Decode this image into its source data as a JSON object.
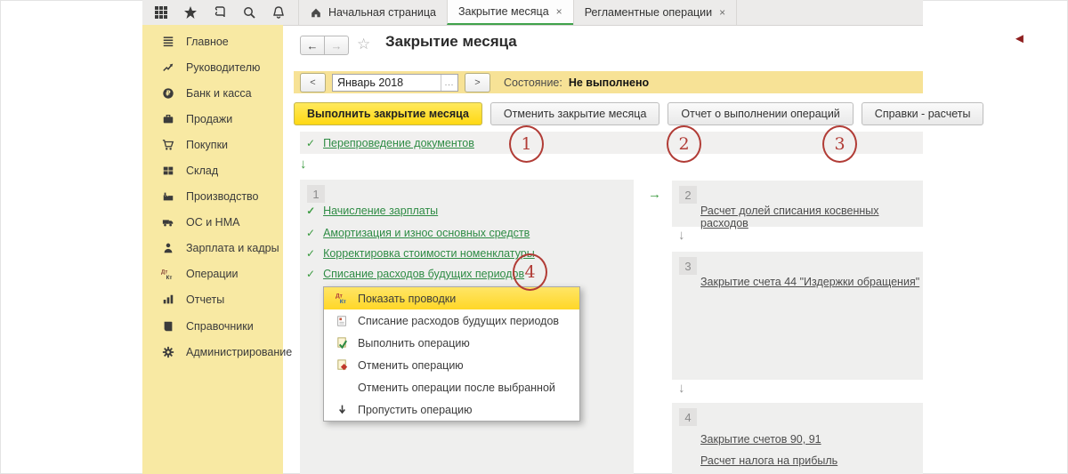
{
  "topbar": {
    "quick_icons": [
      "apps",
      "favorites-star",
      "history",
      "search",
      "notifications-bell"
    ],
    "tabs": [
      {
        "label": "Начальная страница",
        "icon": "home",
        "active": false,
        "closable": false
      },
      {
        "label": "Закрытие месяца",
        "active": true,
        "closable": true
      },
      {
        "label": "Регламентные операции",
        "active": false,
        "closable": true
      }
    ]
  },
  "sidebar": {
    "items": [
      {
        "label": "Главное",
        "icon": "menu-lines"
      },
      {
        "label": "Руководителю",
        "icon": "trend-chart"
      },
      {
        "label": "Банк и касса",
        "icon": "ruble-circle"
      },
      {
        "label": "Продажи",
        "icon": "briefcase"
      },
      {
        "label": "Покупки",
        "icon": "cart"
      },
      {
        "label": "Склад",
        "icon": "grid-boxes"
      },
      {
        "label": "Производство",
        "icon": "factory"
      },
      {
        "label": "ОС и НМА",
        "icon": "truck"
      },
      {
        "label": "Зарплата и кадры",
        "icon": "person"
      },
      {
        "label": "Операции",
        "icon": "dt-kt"
      },
      {
        "label": "Отчеты",
        "icon": "bar-chart"
      },
      {
        "label": "Справочники",
        "icon": "book"
      },
      {
        "label": "Администрирование",
        "icon": "gear"
      }
    ]
  },
  "header": {
    "title": "Закрытие месяца"
  },
  "statusbar": {
    "period_value": "Январь 2018",
    "state_label": "Состояние:",
    "state_value": "Не выполнено"
  },
  "actions": {
    "execute": "Выполнить закрытие месяца",
    "cancel": "Отменить закрытие месяца",
    "report": "Отчет о выполнении операций",
    "refs": "Справки - расчеты"
  },
  "reposting": {
    "label": "Перепроведение документов"
  },
  "annotations": {
    "circles": [
      "1",
      "2",
      "3",
      "4"
    ]
  },
  "stage1": {
    "number": "1",
    "items": [
      "Начисление зарплаты",
      "Амортизация и износ основных средств",
      "Корректировка стоимости номенклатуры",
      "Списание расходов будущих периодов"
    ]
  },
  "stage2": {
    "number": "2",
    "items": [
      "Расчет долей списания косвенных расходов"
    ]
  },
  "stage3": {
    "number": "3",
    "items": [
      "Закрытие счета 44 \"Издержки обращения\""
    ]
  },
  "stage4": {
    "number": "4",
    "items": [
      "Закрытие счетов 90, 91",
      "Расчет налога на прибыль"
    ]
  },
  "context_menu": {
    "items": [
      {
        "label": "Показать проводки",
        "icon": "dt-kt",
        "highlighted": true
      },
      {
        "label": "Списание расходов будущих периодов",
        "icon": "document"
      },
      {
        "label": "Выполнить операцию",
        "icon": "document-check"
      },
      {
        "label": "Отменить операцию",
        "icon": "document-cancel"
      },
      {
        "label": "Отменить операции после выбранной",
        "icon": "none"
      },
      {
        "label": "Пропустить операцию",
        "icon": "arrow-down"
      }
    ]
  },
  "glyphs": {
    "check": "✓",
    "arrow_down": "↓",
    "arrow_right": "→",
    "back_arrow": "←",
    "forward_arrow": "→",
    "star_outline": "☆",
    "prev": "<",
    "next": ">",
    "ellipsis": "...",
    "close": "×",
    "cursor_left": "◄"
  },
  "colors": {
    "sidebar_yellow": "#f8e9a3",
    "period_bar_yellow": "#f7e296",
    "primary_button_yellow": "#ffdd2e",
    "accent_green": "#2e8b44",
    "panel_gray": "#efefee",
    "annotation_red": "#b13c36"
  }
}
